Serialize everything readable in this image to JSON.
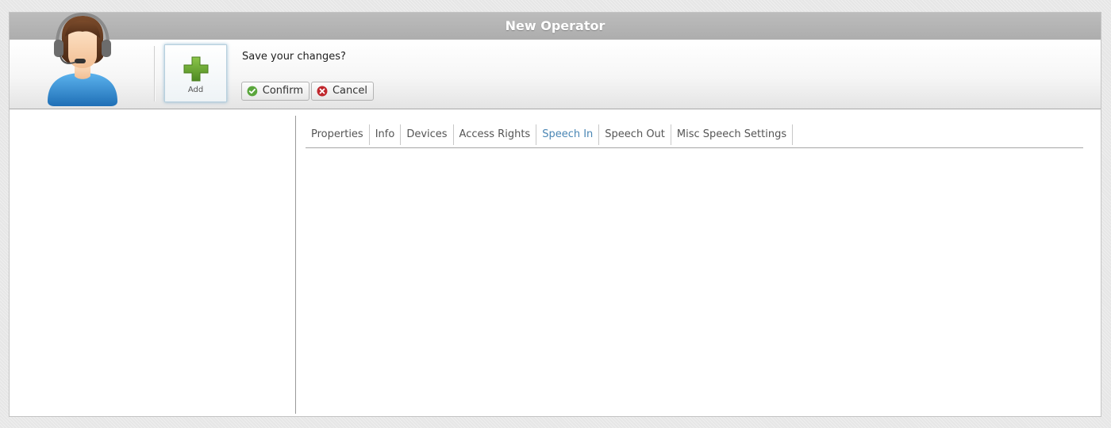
{
  "window": {
    "title": "New Operator"
  },
  "toolbar": {
    "add_label": "Add",
    "prompt": "Save your changes?",
    "confirm_label": "Confirm",
    "cancel_label": "Cancel"
  },
  "tabs": [
    {
      "label": "Properties",
      "active": false
    },
    {
      "label": "Info",
      "active": false
    },
    {
      "label": "Devices",
      "active": false
    },
    {
      "label": "Access Rights",
      "active": false
    },
    {
      "label": "Speech In",
      "active": true
    },
    {
      "label": "Speech Out",
      "active": false
    },
    {
      "label": "Misc Speech Settings",
      "active": false
    }
  ],
  "colors": {
    "active_tab": "#4a86b4",
    "titlebar": "#b3b3b3",
    "confirm_icon": "#5aa63c",
    "cancel_icon": "#c0272d",
    "add_icon": "#5f9e2e"
  },
  "icons": {
    "avatar": "operator-headset-avatar",
    "add": "plus-icon",
    "confirm": "check-circle-icon",
    "cancel": "x-circle-icon"
  }
}
